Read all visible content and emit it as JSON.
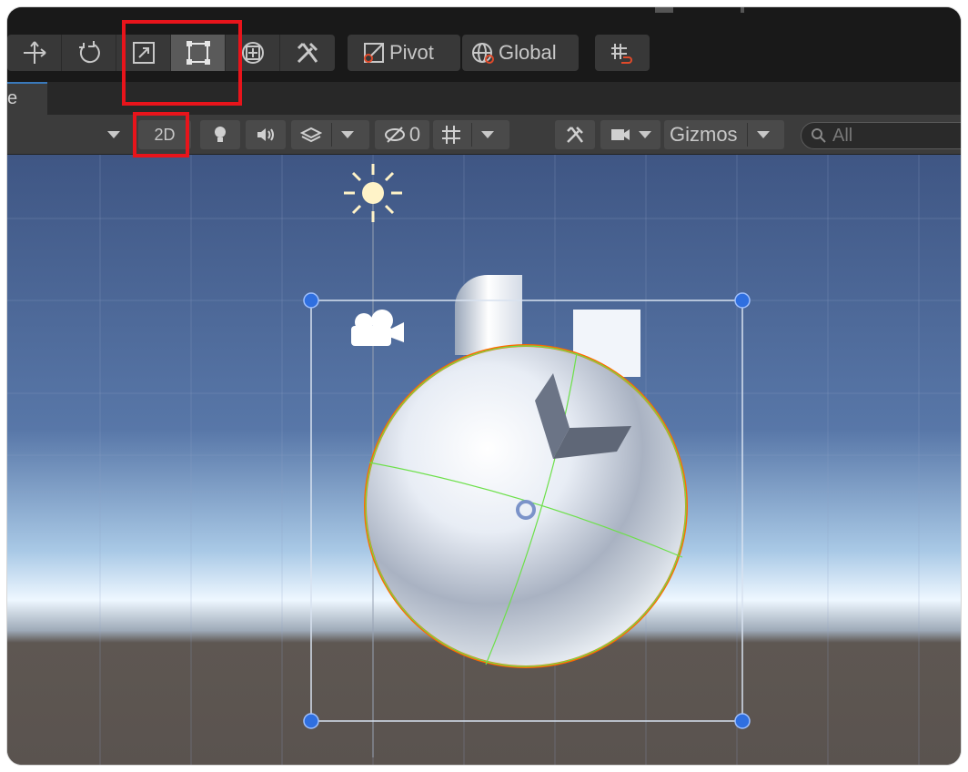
{
  "toolbar": {
    "tools": [
      {
        "icon": "move-icon"
      },
      {
        "icon": "rotate-icon"
      },
      {
        "icon": "scale-icon"
      },
      {
        "icon": "rect-tool-icon",
        "active": true
      },
      {
        "icon": "transform-icon"
      },
      {
        "icon": "custom-tool-icon"
      }
    ],
    "pivot_label": "Pivot",
    "global_label": "Global",
    "snap_icon": "grid-snap-icon"
  },
  "tab": {
    "label": "e"
  },
  "scene_bar": {
    "mode_2d_label": "2D",
    "hidden_count": "0",
    "gizmos_label": "Gizmos",
    "search_placeholder": "All"
  },
  "colors": {
    "highlight": "#e8141b",
    "selection_outline": "#ff6a00",
    "axis_lines": "#6de04a",
    "handles": "#2f6fe0"
  }
}
